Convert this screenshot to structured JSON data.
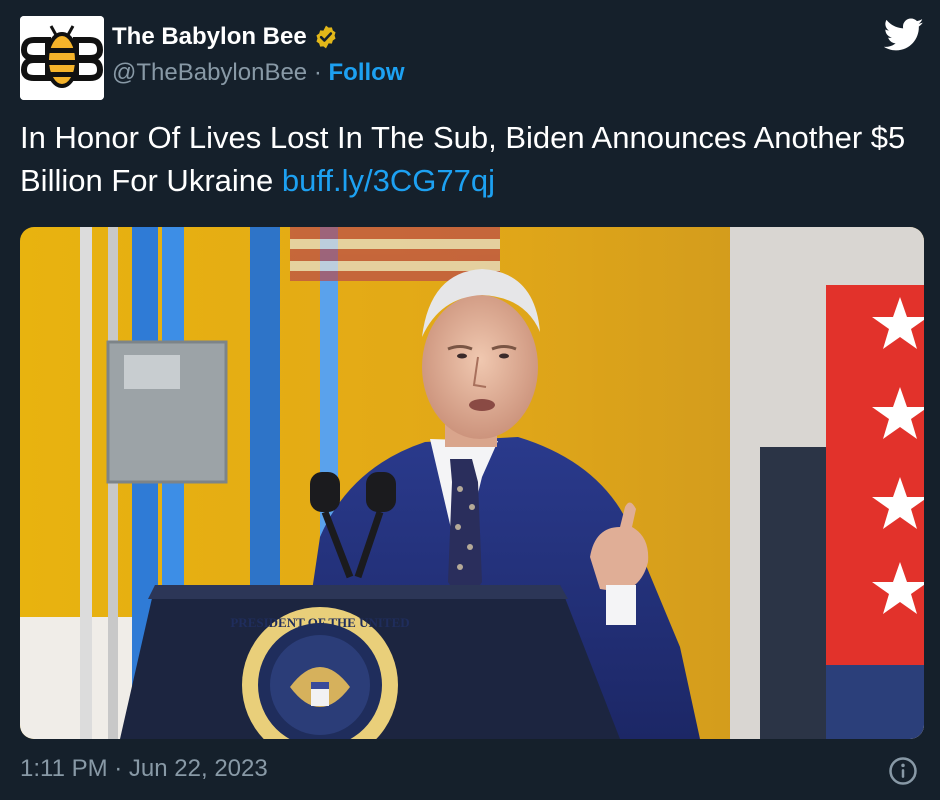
{
  "author": {
    "name": "The Babylon Bee",
    "handle": "@TheBabylonBee",
    "separator": "·",
    "follow_label": "Follow",
    "verified_icon": "verified-badge-icon",
    "avatar_icon": "bee-logo-icon"
  },
  "tweet": {
    "text": "In Honor Of Lives Lost In The Sub, Biden Announces Another $5 Billion For Ukraine",
    "link": "buff.ly/3CG77qj"
  },
  "media": {
    "description_icon": "photo-of-speaker-at-podium",
    "seal_text": "PRESIDENT OF THE UNITED"
  },
  "meta": {
    "timestamp": "1:11 PM · Jun 22, 2023",
    "info_icon": "info-icon"
  },
  "colors": {
    "background": "#15202b",
    "accent": "#1da1f2",
    "secondary_text": "#8899a6",
    "verified_gold": "#e2b719"
  }
}
